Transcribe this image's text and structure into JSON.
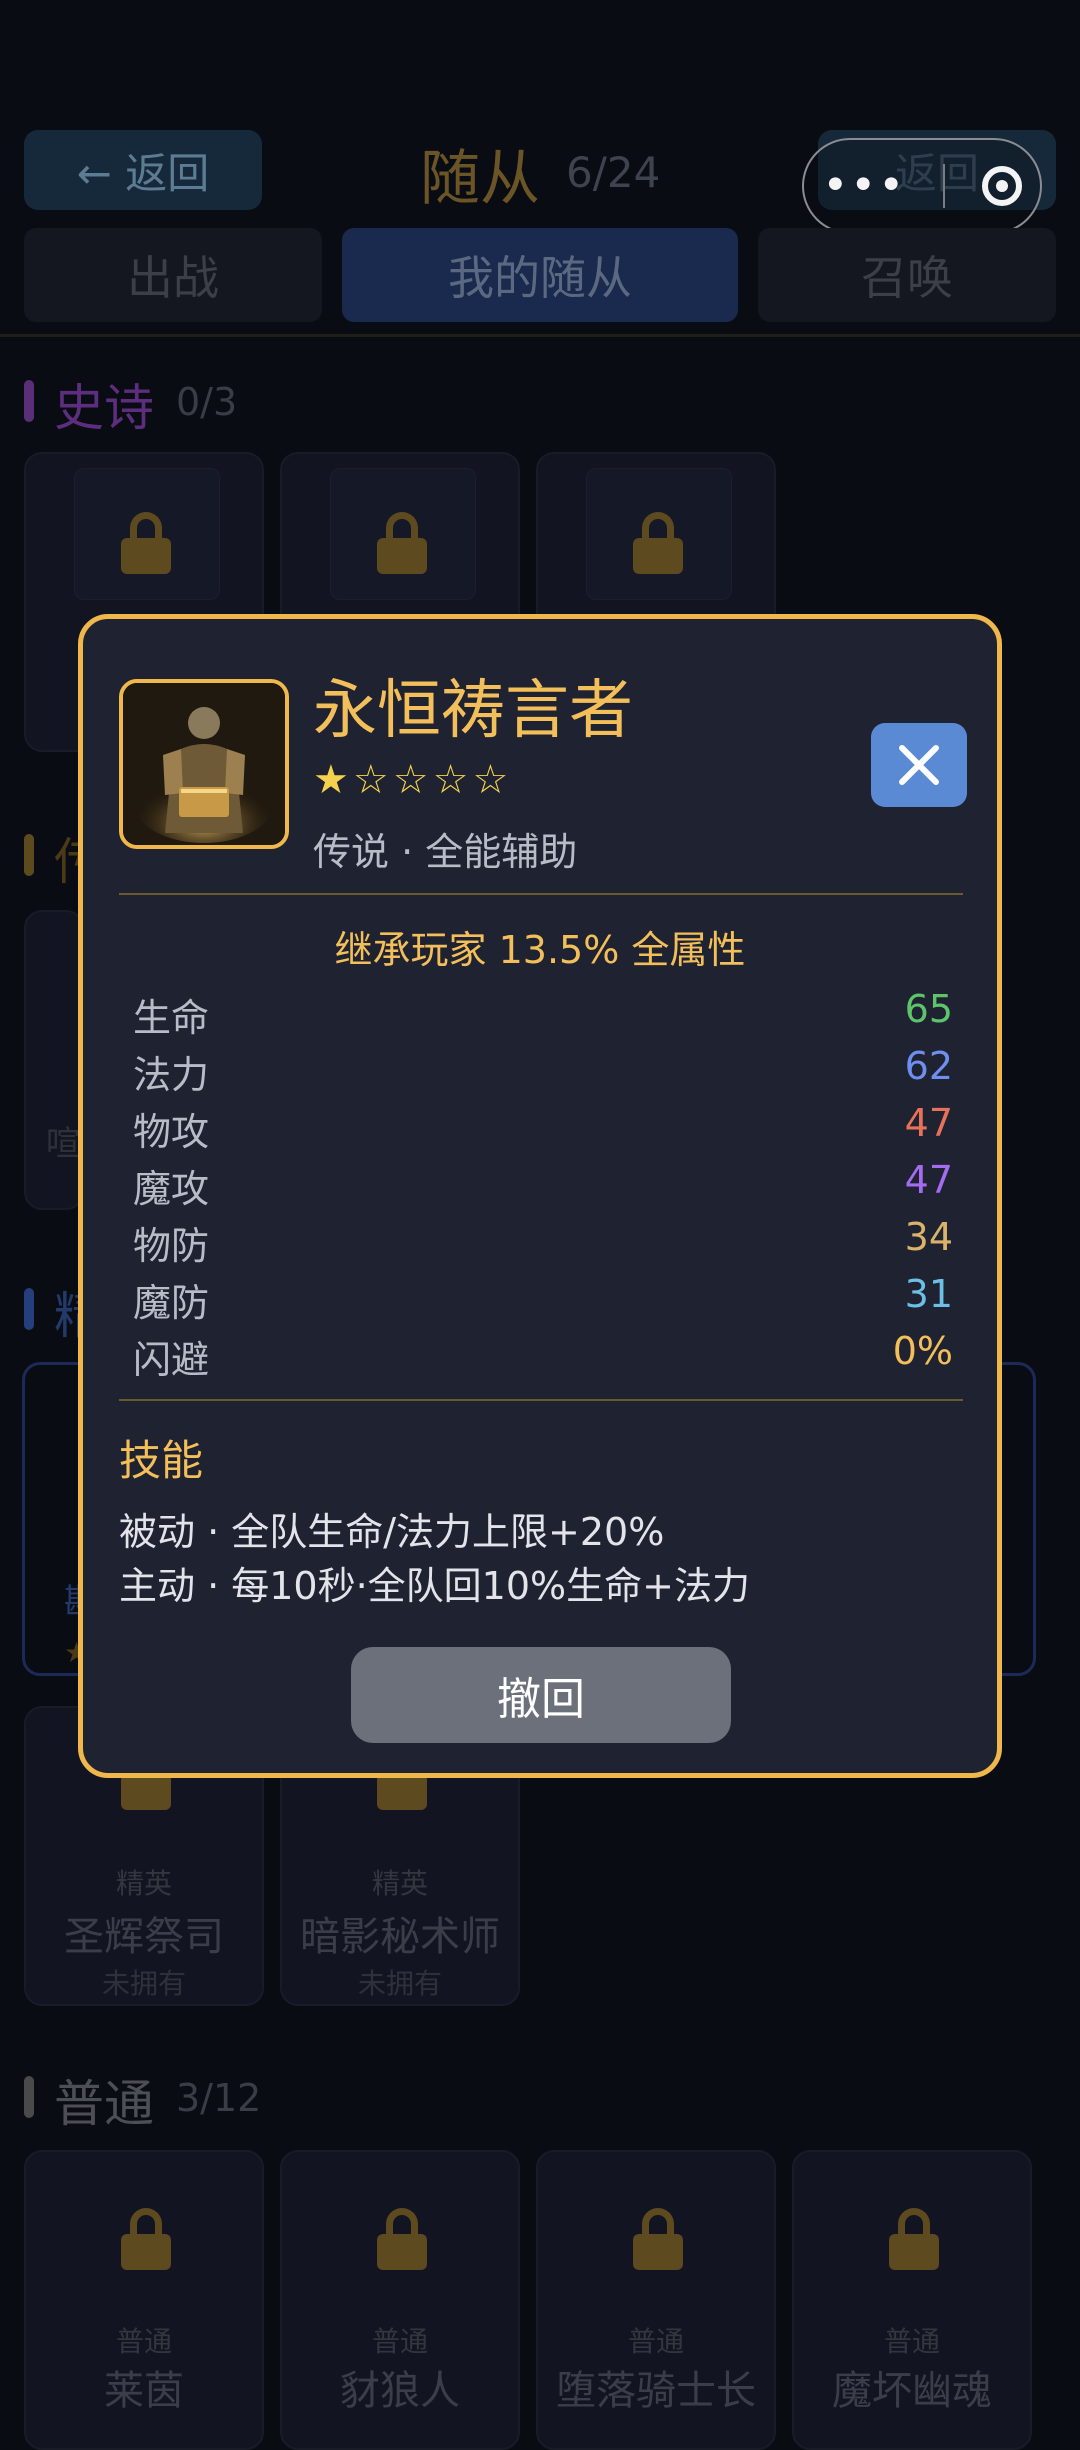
{
  "header": {
    "back_label": "← 返回",
    "back2_label": "返回",
    "title": "随从",
    "count": "6/24",
    "menu_dots": "•••"
  },
  "tabs": [
    {
      "label": "出战"
    },
    {
      "label": "我的随从"
    },
    {
      "label": "召唤"
    }
  ],
  "sections": {
    "epic": {
      "title": "史诗",
      "count": "0/3",
      "color": "#7a3ea0"
    },
    "legend": {
      "title": "传",
      "color": "#7a5a20"
    },
    "elite": {
      "title": "精",
      "color": "#2d4f9a"
    },
    "normal": {
      "title": "普通",
      "count": "3/12",
      "color": "#5a5a5a"
    }
  },
  "bg_cards": {
    "elite_row2": [
      {
        "rarity": "精英",
        "name": "圣辉祭司",
        "status": "未拥有"
      },
      {
        "rarity": "精英",
        "name": "暗影秘术师",
        "status": "未拥有"
      }
    ],
    "normal_row": [
      {
        "rarity": "普通",
        "name": "莱茵"
      },
      {
        "rarity": "普通",
        "name": "豺狼人"
      },
      {
        "rarity": "普通",
        "name": "堕落骑士长"
      },
      {
        "rarity": "普通",
        "name": "魔坏幽魂"
      }
    ],
    "fragments": {
      "left_mid": "喧",
      "left_low": "斟",
      "left_star": "★"
    }
  },
  "modal": {
    "name": "永恒祷言者",
    "stars": "★☆☆☆☆",
    "subtitle": "传说 · 全能辅助",
    "inherit": "继承玩家 13.5% 全属性",
    "stats": [
      {
        "label": "生命",
        "value": "65",
        "color": "#5ec46b"
      },
      {
        "label": "法力",
        "value": "62",
        "color": "#6f8ff0"
      },
      {
        "label": "物攻",
        "value": "47",
        "color": "#e8715a"
      },
      {
        "label": "魔攻",
        "value": "47",
        "color": "#a46cf0"
      },
      {
        "label": "物防",
        "value": "34",
        "color": "#d9b36a"
      },
      {
        "label": "魔防",
        "value": "31",
        "color": "#6cc0e8"
      },
      {
        "label": "闪避",
        "value": "0%",
        "color": "#f3bf5a"
      }
    ],
    "skills_title": "技能",
    "skills": [
      "被动 · 全队生命/法力上限+20%",
      "主动 · 每10秒·全队回10%生命+法力"
    ],
    "recall_label": "撤回"
  }
}
